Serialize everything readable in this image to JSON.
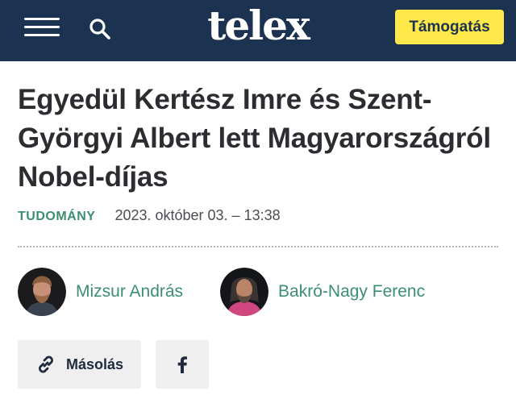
{
  "header": {
    "logo": "telex",
    "support_label": "Támogatás",
    "menu_icon": "hamburger-menu-icon",
    "search_icon": "search-icon",
    "background": "#1c3251",
    "support_color": "#ffe94a"
  },
  "article": {
    "title": "Egyedül Kertész Imre és Szent-Györgyi Albert lett Magyarországról Nobel-díjas",
    "category": "TUDOMÁNY",
    "date": "2023. október 03. – 13:38",
    "accent_color": "#3b8f6f"
  },
  "authors": [
    {
      "name": "Mizsur András",
      "avatar": "author-photo"
    },
    {
      "name": "Bakró-Nagy Ferenc",
      "avatar": "author-photo"
    }
  ],
  "share": {
    "copy_label": "Másolás",
    "copy_icon": "link-icon",
    "facebook_icon": "facebook-icon"
  }
}
